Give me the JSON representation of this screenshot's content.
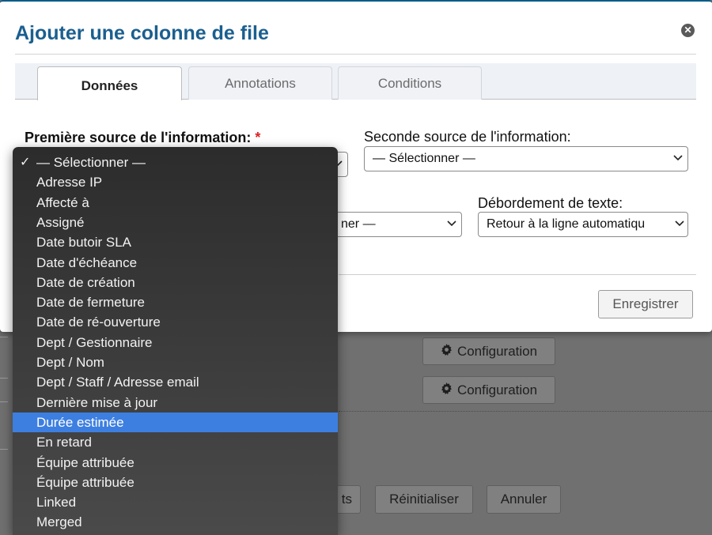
{
  "dialog": {
    "title": "Ajouter une colonne de file",
    "tabs": [
      {
        "label": "Données",
        "active": true
      },
      {
        "label": "Annotations",
        "active": false
      },
      {
        "label": "Conditions",
        "active": false
      }
    ],
    "primary_label": "Première source de l'information:",
    "required_mark": "*",
    "secondary_label": "Seconde source de l'information:",
    "secondary_value": "— Sélectionner —",
    "third_value_partial": "ner —",
    "overflow_label": "Débordement de texte:",
    "overflow_value": "Retour à la ligne automatiqu",
    "save_label": "Enregistrer"
  },
  "background": {
    "config_label": "Configuration",
    "reset_label": "Réinitialiser",
    "cancel_label": "Annuler",
    "partial_button": "ts"
  },
  "dropdown": {
    "checkmark": "✓",
    "selected_index": 0,
    "highlighted_index": 13,
    "options": [
      "— Sélectionner —",
      "Adresse IP",
      "Affecté à",
      "Assigné",
      "Date butoir SLA",
      "Date d'échéance",
      "Date de création",
      "Date de fermeture",
      "Date de ré-ouverture",
      "Dept / Gestionnaire",
      "Dept / Nom",
      "Dept / Staff / Adresse email",
      "Dernière mise à jour",
      "Durée estimée",
      "En retard",
      "Équipe attribuée",
      "Équipe attribuée",
      "Linked",
      "Merged"
    ]
  },
  "colors": {
    "title": "#1b5f8f",
    "highlight": "#3d7fe0",
    "required": "#dd2222"
  },
  "icons": [
    "close-icon",
    "gear-icon",
    "chevron-down-icon",
    "check-icon"
  ]
}
